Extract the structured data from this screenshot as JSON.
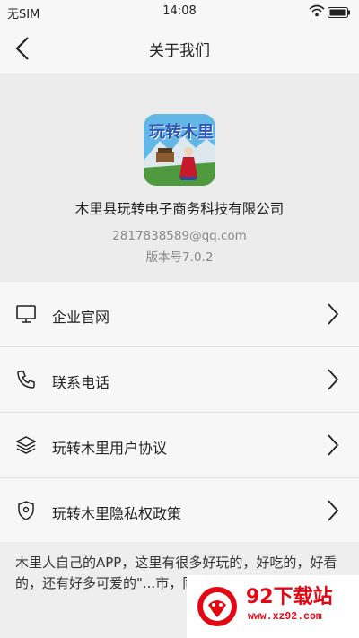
{
  "status_bar": {
    "carrier": "无SIM",
    "time": "14:08"
  },
  "nav": {
    "title": "关于我们"
  },
  "app": {
    "logo_text": "玩转木里",
    "company": "木里县玩转电子商务科技有限公司",
    "email": "2817838589@qq.com",
    "version": "版本号7.0.2"
  },
  "menu": [
    {
      "label": "企业官网",
      "icon": "monitor-icon"
    },
    {
      "label": "联系电话",
      "icon": "phone-icon"
    },
    {
      "label": "玩转木里用户协议",
      "icon": "layers-icon"
    },
    {
      "label": "玩转木里隐私权政策",
      "icon": "shield-icon"
    }
  ],
  "intro": {
    "text": "木里人自己的APP，这里有很多好玩的，好吃的，好看的，还有好多可爱的\"...市，同一个梦想！"
  },
  "watermark": {
    "title": "92下载站",
    "url": "www.xz92.com"
  },
  "colors": {
    "accent_red": "#e30613",
    "background": "#f3f3f3",
    "header_gray": "#ececec"
  }
}
